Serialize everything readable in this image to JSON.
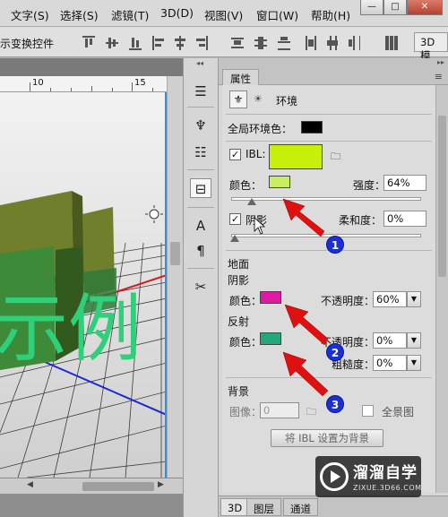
{
  "menu": {
    "items": [
      "文字(S)",
      "选择(S)",
      "滤镜(T)",
      "3D(D)",
      "视图(V)",
      "窗口(W)",
      "帮助(H)"
    ],
    "window_buttons": [
      "—",
      "□",
      "✕"
    ]
  },
  "options_bar": {
    "label": "示变换控件",
    "mode_label": "3D 模"
  },
  "ruler": {
    "labels": [
      "10",
      "15"
    ]
  },
  "canvas": {
    "text_glyphs": "示例"
  },
  "tools": {
    "icons": [
      "layers-3d-icon",
      "brush-icon",
      "sliders-icon",
      "properties-icon",
      "character-icon",
      "paragraph-icon",
      "tools-icon"
    ],
    "glyphs": [
      "☰",
      "♆",
      "☷",
      "⊟",
      "A",
      "¶",
      "✂"
    ]
  },
  "panel": {
    "top_collapse": "▸▸",
    "tab_label": "属性",
    "header_title": "环境",
    "global_ambient_label": "全局环境色：",
    "ibl_label": "IBL:",
    "ibl_checked": true,
    "color_label": "颜色：",
    "strength_label": "强度：",
    "strength_value": "64%",
    "shadow_label": "阴影",
    "shadow_checked": true,
    "softness_label": "柔和度：",
    "softness_value": "0%",
    "ground_label": "地面",
    "ground_shadow_label": "阴影",
    "ground_shadow_color_label": "颜色：",
    "opacity_label": "不透明度：",
    "ground_shadow_opacity": "60%",
    "reflection_label": "反射",
    "reflection_color_label": "颜色：",
    "reflection_opacity_label": "不透明度：",
    "reflection_opacity": "0%",
    "roughness_label": "粗糙度：",
    "roughness_value": "0%",
    "background_label": "背景",
    "image_label": "图像：",
    "image_value": "0",
    "panorama_label": "全景图",
    "set_ibl_button": "将 IBL 设置为背景",
    "bottom_tabs": [
      "3D",
      "图层",
      "通道"
    ],
    "colors": {
      "global_ambient": "#000000",
      "ibl": "#c6f00a",
      "ibl_color": "#c6f060",
      "ground_shadow": "#e01aa0",
      "reflection": "#22a87a"
    }
  },
  "annotations": {
    "badges": [
      "1",
      "2",
      "3"
    ],
    "arrow_color": "#e01010"
  },
  "watermark": {
    "title": "溜溜自学",
    "subtitle": "ZIXUE.3D66.COM"
  }
}
